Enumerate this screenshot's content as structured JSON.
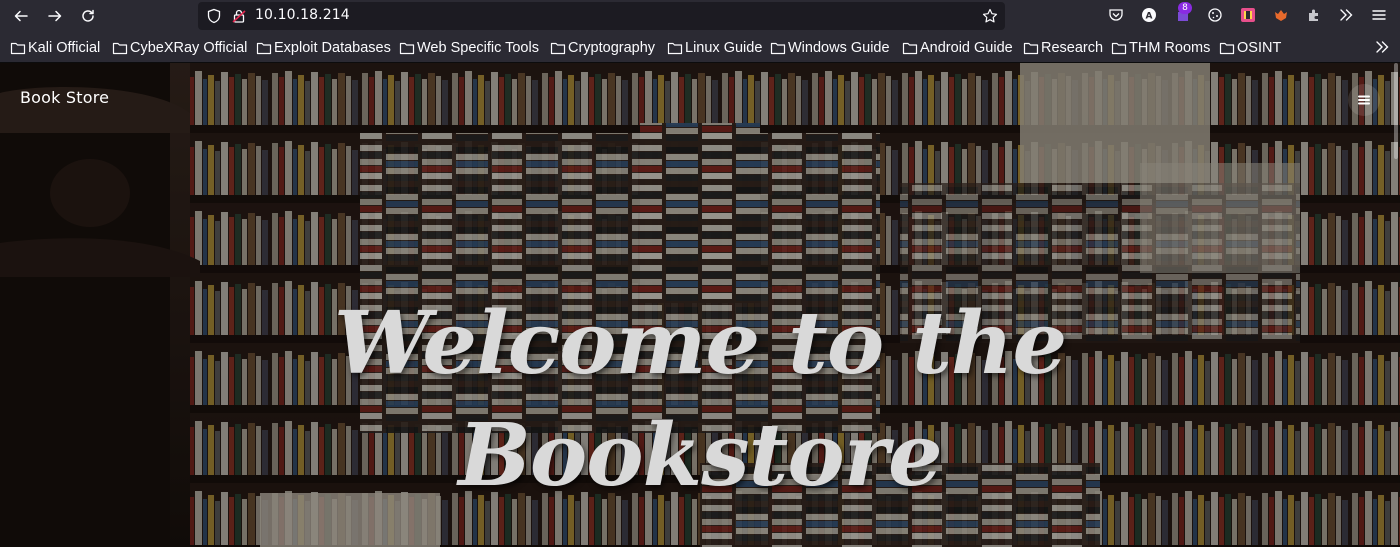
{
  "browser": {
    "url": "10.10.18.214",
    "extension_badge": "8",
    "bookmarks": [
      {
        "label": "Kali Official"
      },
      {
        "label": "CybeXRay Official"
      },
      {
        "label": "Exploit Databases"
      },
      {
        "label": "Web Specific Tools"
      },
      {
        "label": "Cryptography"
      },
      {
        "label": "Linux Guide"
      },
      {
        "label": "Windows Guide"
      },
      {
        "label": "Android Guide"
      },
      {
        "label": "Research"
      },
      {
        "label": "THM Rooms"
      },
      {
        "label": "OSINT"
      }
    ]
  },
  "page": {
    "brand": "Book Store",
    "hero_line1": "Welcome to the",
    "hero_line2": "Bookstore"
  },
  "colors": {
    "toolbar": "#2b2a33",
    "urlbar": "#1c1b22",
    "text": "#fbfbfe"
  }
}
